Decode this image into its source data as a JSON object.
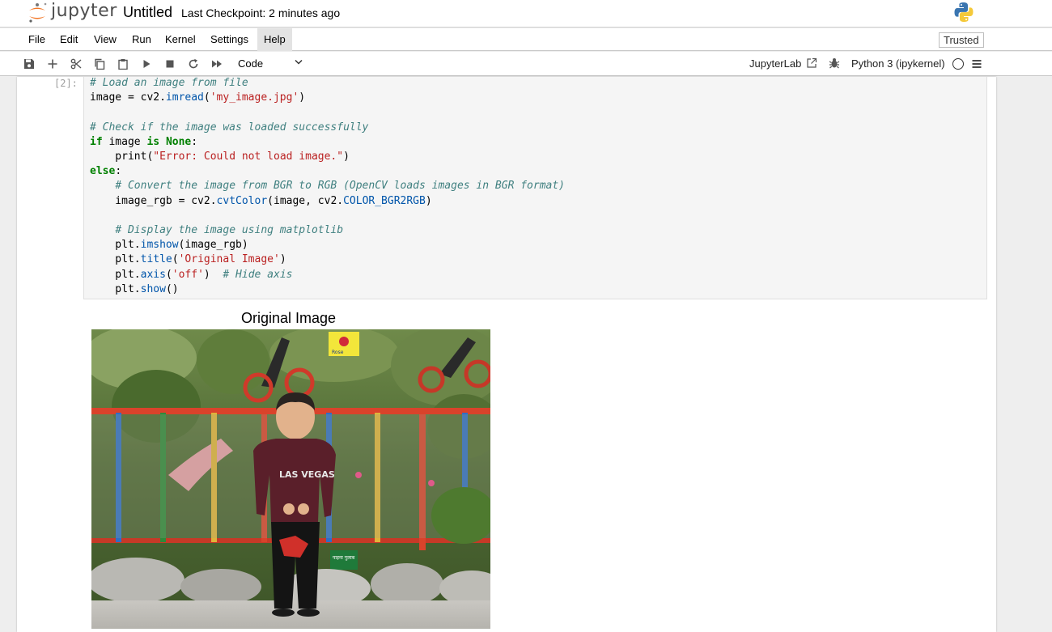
{
  "header": {
    "logo_text": "jupyter",
    "notebook_title": "Untitled",
    "checkpoint": "Last Checkpoint: 2 minutes ago"
  },
  "menubar": {
    "items": [
      "File",
      "Edit",
      "View",
      "Run",
      "Kernel",
      "Settings",
      "Help"
    ],
    "active": "Help",
    "trusted_label": "Trusted"
  },
  "toolbar": {
    "cell_type": "Code",
    "jupyterlab_label": "JupyterLab",
    "kernel_name": "Python 3 (ipykernel)"
  },
  "cell": {
    "prompt": "[2]:",
    "code_lines": [
      "# Load an image from file",
      "image = cv2.imread('my_image.jpg')",
      "",
      "# Check if the image was loaded successfully",
      "if image is None:",
      "    print(\"Error: Could not load image.\")",
      "else:",
      "    # Convert the image from BGR to RGB (OpenCV loads images in BGR format)",
      "    image_rgb = cv2.cvtColor(image, cv2.COLOR_BGR2RGB)",
      "",
      "    # Display the image using matplotlib",
      "    plt.imshow(image_rgb)",
      "    plt.title('Original Image')",
      "    plt.axis('off')  # Hide axis",
      "    plt.show()"
    ]
  },
  "output": {
    "title": "Original Image",
    "sign_rose_text": "Rose",
    "sign_plant_text": "पाइना गुलाब",
    "shirt_text": "LAS VEGAS"
  },
  "colors": {
    "jupyter_orange": "#F37726",
    "fence_red": "#D9432B",
    "prompt_gray": "#9e9e9e"
  }
}
